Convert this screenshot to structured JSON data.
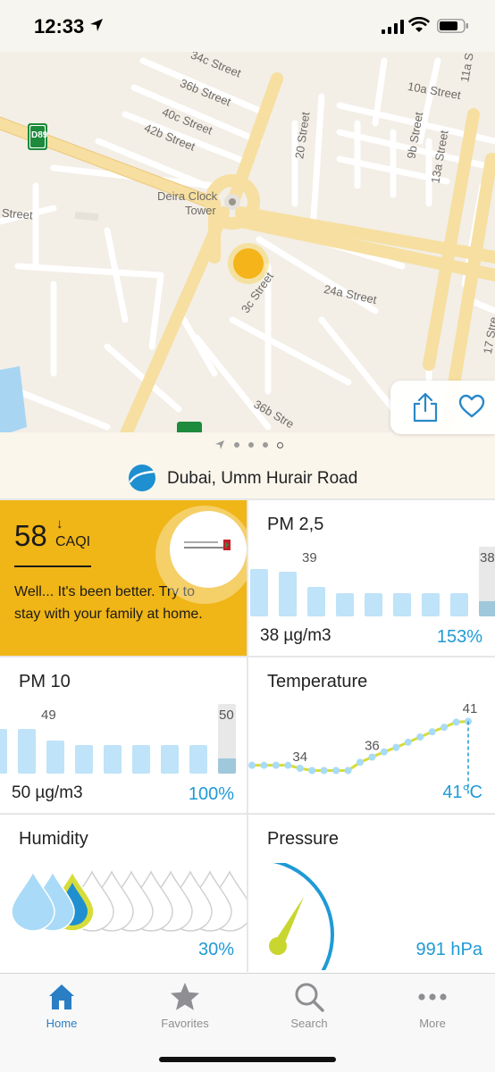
{
  "status_bar": {
    "time": "12:33"
  },
  "map": {
    "street_labels": [
      "34c Street",
      "36b Street",
      "40c Street",
      "42b Street",
      "10a Street",
      "9b Street",
      "13a Street",
      "20 Street",
      "Street",
      "24a Street",
      "3c Street",
      "36b Stre",
      "17 Stre",
      "11a S",
      "Deira Clock",
      "Tower"
    ],
    "road_badge": "D89"
  },
  "pager": {
    "pages": 5,
    "current_index": 4
  },
  "location": {
    "name": "Dubai, Umm Hurair Road"
  },
  "aqi": {
    "value": "58",
    "arrow": "↓",
    "unit": "CAQI",
    "message": "Well... It's been better. Try to stay with your family at home.",
    "color": "#f0b516"
  },
  "pm25": {
    "title": "PM 2,5",
    "value": "38 µg/m3",
    "percent": "153%",
    "max_label": "39",
    "current_label": "38",
    "bars": [
      0.74,
      0.7,
      0.46,
      0.36,
      0.36,
      0.36,
      0.36,
      0.36
    ],
    "current_fill": 0.34
  },
  "pm10": {
    "title": "PM 10",
    "value": "50 µg/m3",
    "percent": "100%",
    "max_label": "49",
    "current_label": "50",
    "bars": [
      0.7,
      0.7,
      0.52,
      0.45,
      0.45,
      0.45,
      0.45,
      0.45
    ],
    "current_fill": 0.34
  },
  "temperature": {
    "title": "Temperature",
    "value": "41°C",
    "labels": [
      "34",
      "36",
      "41"
    ],
    "points": [
      34,
      34,
      34,
      34,
      33.6,
      33.3,
      33.3,
      33.3,
      33.3,
      34.4,
      35.1,
      35.8,
      36.4,
      37.1,
      37.8,
      38.5,
      39.1,
      39.8,
      39.9
    ]
  },
  "humidity": {
    "title": "Humidity",
    "value": "30%",
    "level_fraction": 0.3,
    "drops": 11
  },
  "pressure": {
    "title": "Pressure",
    "value": "991 hPa"
  },
  "tabs": [
    {
      "label": "Home",
      "icon": "home-icon",
      "active": true
    },
    {
      "label": "Favorites",
      "icon": "star-icon",
      "active": false
    },
    {
      "label": "Search",
      "icon": "search-icon",
      "active": false
    },
    {
      "label": "More",
      "icon": "more-icon",
      "active": false
    }
  ],
  "colors": {
    "accent_blue": "#1f9ad6",
    "bar_blue": "#bfe3f8",
    "chart_yellow": "#d6dc3a",
    "chart_dot": "#a8dbf6",
    "map_bg": "#f3eee6",
    "road_yellow": "#f6dfa0"
  }
}
